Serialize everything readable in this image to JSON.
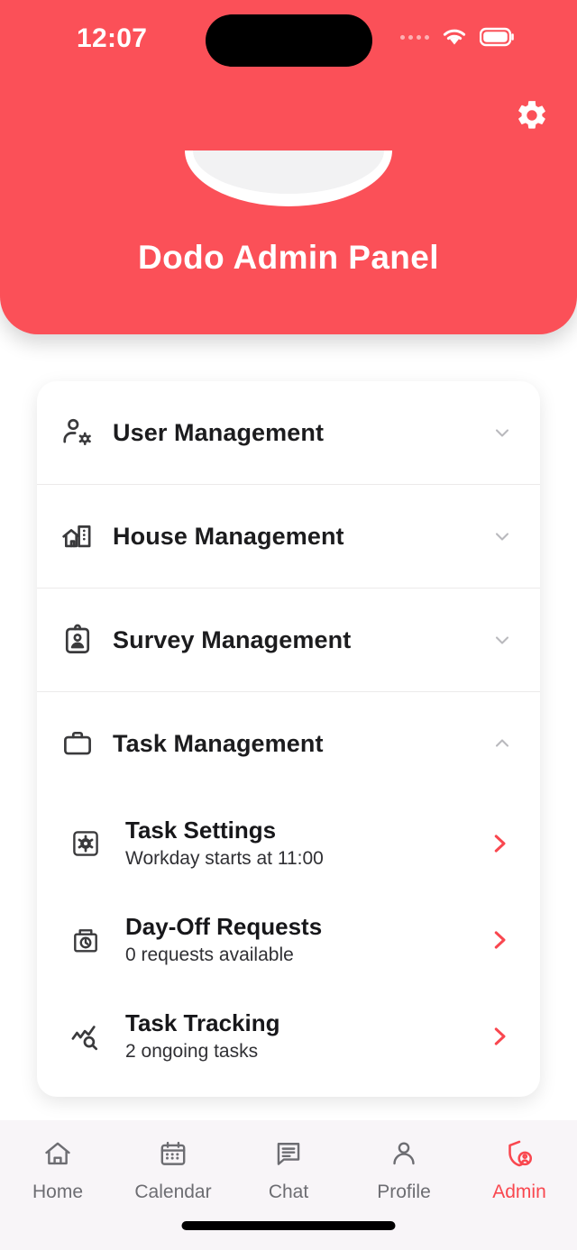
{
  "status_bar": {
    "time": "12:07",
    "signal_icon": "signal-dots-icon",
    "wifi_icon": "wifi-icon",
    "battery_icon": "battery-icon"
  },
  "header": {
    "title": "Dodo Admin Panel",
    "settings_icon": "gear-icon",
    "logo_icon": "bowl-logo",
    "background_color": "#fb5058"
  },
  "menu": {
    "sections": [
      {
        "label": "User Management",
        "icon": "user-settings-icon",
        "expanded": false,
        "chevron": "chevron-down-icon"
      },
      {
        "label": "House Management",
        "icon": "house-building-icon",
        "expanded": false,
        "chevron": "chevron-down-icon"
      },
      {
        "label": "Survey Management",
        "icon": "id-badge-icon",
        "expanded": false,
        "chevron": "chevron-down-icon"
      },
      {
        "label": "Task Management",
        "icon": "briefcase-icon",
        "expanded": true,
        "chevron": "chevron-up-icon",
        "items": [
          {
            "title": "Task Settings",
            "subtitle": "Workday starts at 11:00",
            "icon": "gear-square-icon",
            "arrow": "chevron-right-icon"
          },
          {
            "title": "Day-Off Requests",
            "subtitle": "0 requests available",
            "icon": "bag-clock-icon",
            "arrow": "chevron-right-icon"
          },
          {
            "title": "Task Tracking",
            "subtitle": "2 ongoing tasks",
            "icon": "trend-search-icon",
            "arrow": "chevron-right-icon"
          }
        ]
      }
    ]
  },
  "bottom_nav": {
    "active_color": "#f9474f",
    "inactive_color": "#6d6d72",
    "items": [
      {
        "label": "Home",
        "icon": "home-icon",
        "active": false
      },
      {
        "label": "Calendar",
        "icon": "calendar-icon",
        "active": false
      },
      {
        "label": "Chat",
        "icon": "chat-icon",
        "active": false
      },
      {
        "label": "Profile",
        "icon": "person-icon",
        "active": false
      },
      {
        "label": "Admin",
        "icon": "shield-person-icon",
        "active": true
      }
    ]
  }
}
